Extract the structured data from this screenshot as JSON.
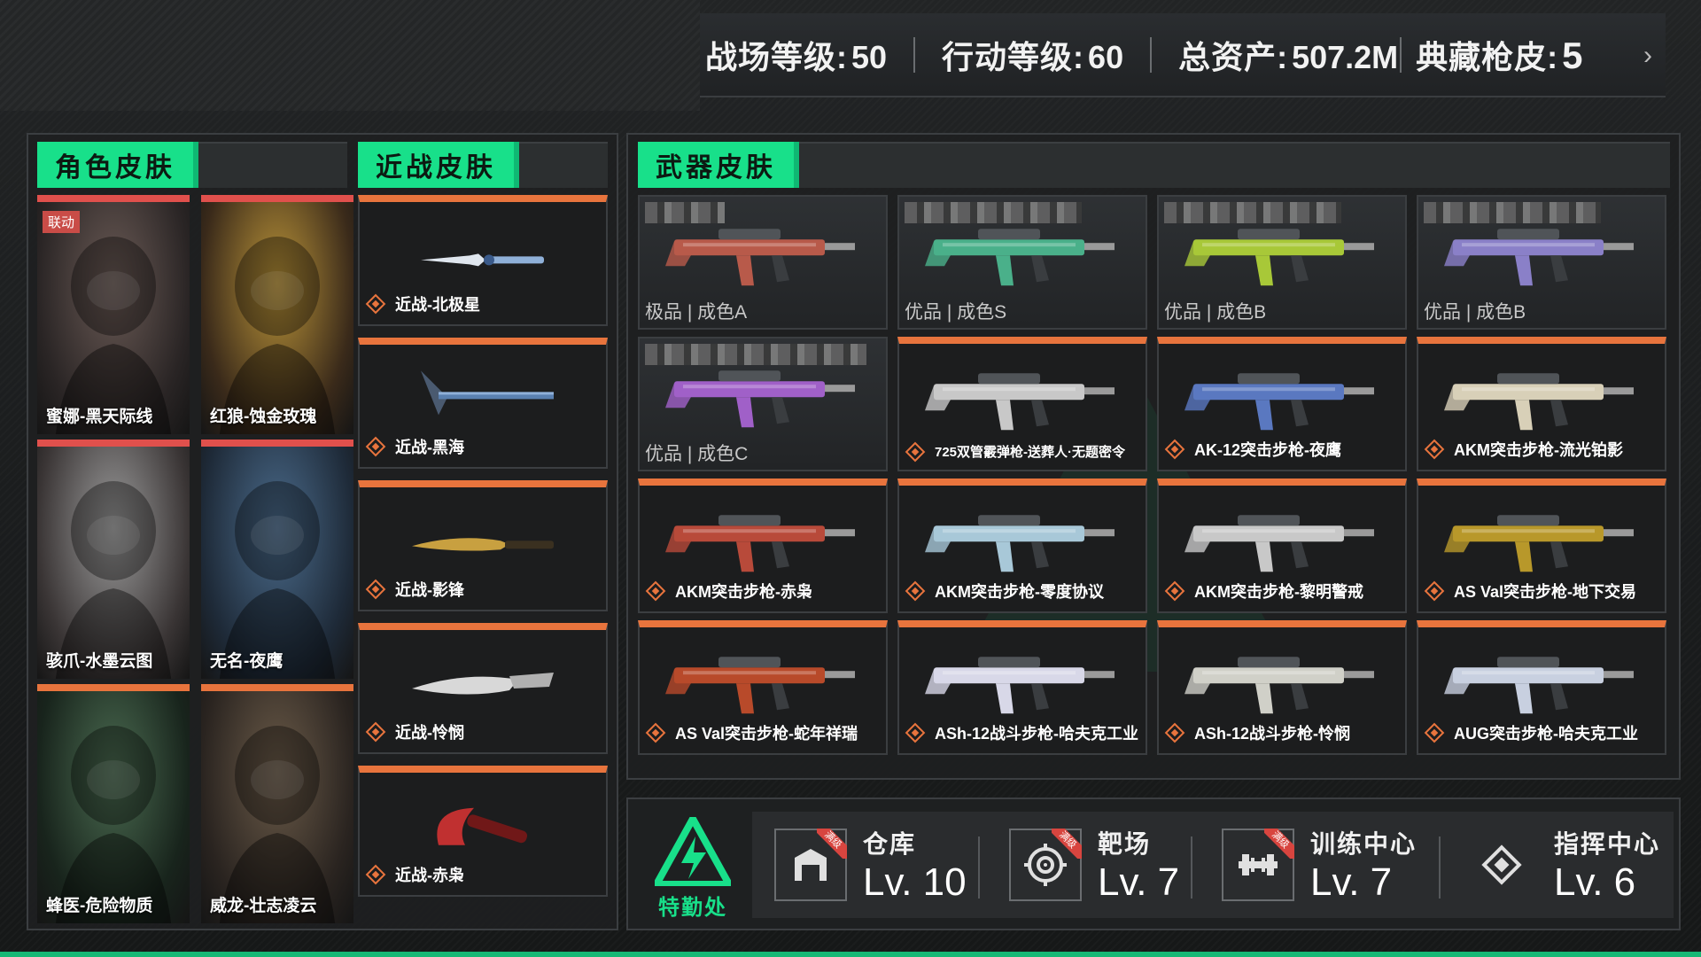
{
  "top_stats": [
    {
      "label": "战场等级:",
      "value": "50"
    },
    {
      "label": "行动等级:",
      "value": "60"
    },
    {
      "label": "总资产:",
      "value": "507.2M"
    },
    {
      "label": "典藏枪皮:",
      "value": "5"
    }
  ],
  "top_chevron": "›",
  "sections": {
    "character": "角色皮肤",
    "melee": "近战皮肤",
    "weapon": "武器皮肤"
  },
  "collab_badge": "联动",
  "character_skins": [
    {
      "name": "蜜娜-黑天际线",
      "colors": [
        "#6a5a55",
        "#2a2525"
      ]
    },
    {
      "name": "红狼-蚀金玫瑰",
      "colors": [
        "#b89238",
        "#3a2a1a"
      ]
    },
    {
      "name": "骇爪-水墨云图",
      "colors": [
        "#9a9a9a",
        "#3a3535"
      ]
    },
    {
      "name": "无名-夜鹰",
      "colors": [
        "#4a6a8a",
        "#1e2a38"
      ]
    },
    {
      "name": "蜂医-危险物质",
      "colors": [
        "#4a6a50",
        "#18241c"
      ]
    },
    {
      "name": "威龙-壮志凌云",
      "colors": [
        "#6a5a48",
        "#2a2420"
      ]
    }
  ],
  "melee_skins": [
    {
      "name": "近战-北极星",
      "color": "#8fb0d8"
    },
    {
      "name": "近战-黑海",
      "color": "#5a80b0"
    },
    {
      "name": "近战-影锋",
      "color": "#c8a040"
    },
    {
      "name": "近战-怜悯",
      "color": "#d8d8d8"
    },
    {
      "name": "近战-赤枭",
      "color": "#c03030"
    }
  ],
  "weapon_skins": [
    {
      "grade": "极品 | 成色A",
      "name": "",
      "color": "#b85a4a",
      "featured": true
    },
    {
      "grade": "优品 | 成色S",
      "name": "",
      "color": "#4ab08a",
      "featured": true
    },
    {
      "grade": "优品 | 成色B",
      "name": "",
      "color": "#a8c838",
      "featured": true
    },
    {
      "grade": "优品 | 成色B",
      "name": "",
      "color": "#8a80c8",
      "featured": true
    },
    {
      "grade": "优品 | 成色C",
      "name": "",
      "color": "#a060c8",
      "featured": true
    },
    {
      "grade": "",
      "name": "725双管霰弹枪-送葬人·无题密令",
      "color": "#c8c8c8",
      "featured": false
    },
    {
      "grade": "",
      "name": "AK-12突击步枪-夜鹰",
      "color": "#5a78c0",
      "featured": false
    },
    {
      "grade": "",
      "name": "AKM突击步枪-流光铂影",
      "color": "#d8d0b8",
      "featured": false
    },
    {
      "grade": "",
      "name": "AKM突击步枪-赤枭",
      "color": "#b84a3a",
      "featured": false
    },
    {
      "grade": "",
      "name": "AKM突击步枪-零度协议",
      "color": "#a8c8d8",
      "featured": false
    },
    {
      "grade": "",
      "name": "AKM突击步枪-黎明警戒",
      "color": "#c8c8c8",
      "featured": false
    },
    {
      "grade": "",
      "name": "AS Val突击步枪-地下交易",
      "color": "#b8982a",
      "featured": false
    },
    {
      "grade": "",
      "name": "AS Val突击步枪-蛇年祥瑞",
      "color": "#b84a2a",
      "featured": false
    },
    {
      "grade": "",
      "name": "ASh-12战斗步枪-哈夫克工业",
      "color": "#d8d8e8",
      "featured": false
    },
    {
      "grade": "",
      "name": "ASh-12战斗步枪-怜悯",
      "color": "#d0d0c8",
      "featured": false
    },
    {
      "grade": "",
      "name": "AUG突击步枪-哈夫克工业",
      "color": "#c8d0e0",
      "featured": false
    }
  ],
  "facility": {
    "logo_text": "特勤处",
    "full_badge": "满级",
    "items": [
      {
        "name": "仓库",
        "level": "Lv. 10",
        "icon": "warehouse-icon",
        "full": true
      },
      {
        "name": "靶场",
        "level": "Lv. 7",
        "icon": "target-icon",
        "full": true
      },
      {
        "name": "训练中心",
        "level": "Lv. 7",
        "icon": "dumbbell-icon",
        "full": true
      },
      {
        "name": "指挥中心",
        "level": "Lv. 6",
        "icon": "command-icon",
        "full": false
      }
    ]
  },
  "colors": {
    "accent_green": "#18e08a",
    "accent_orange": "#e8743d",
    "accent_red": "#e0504c"
  }
}
